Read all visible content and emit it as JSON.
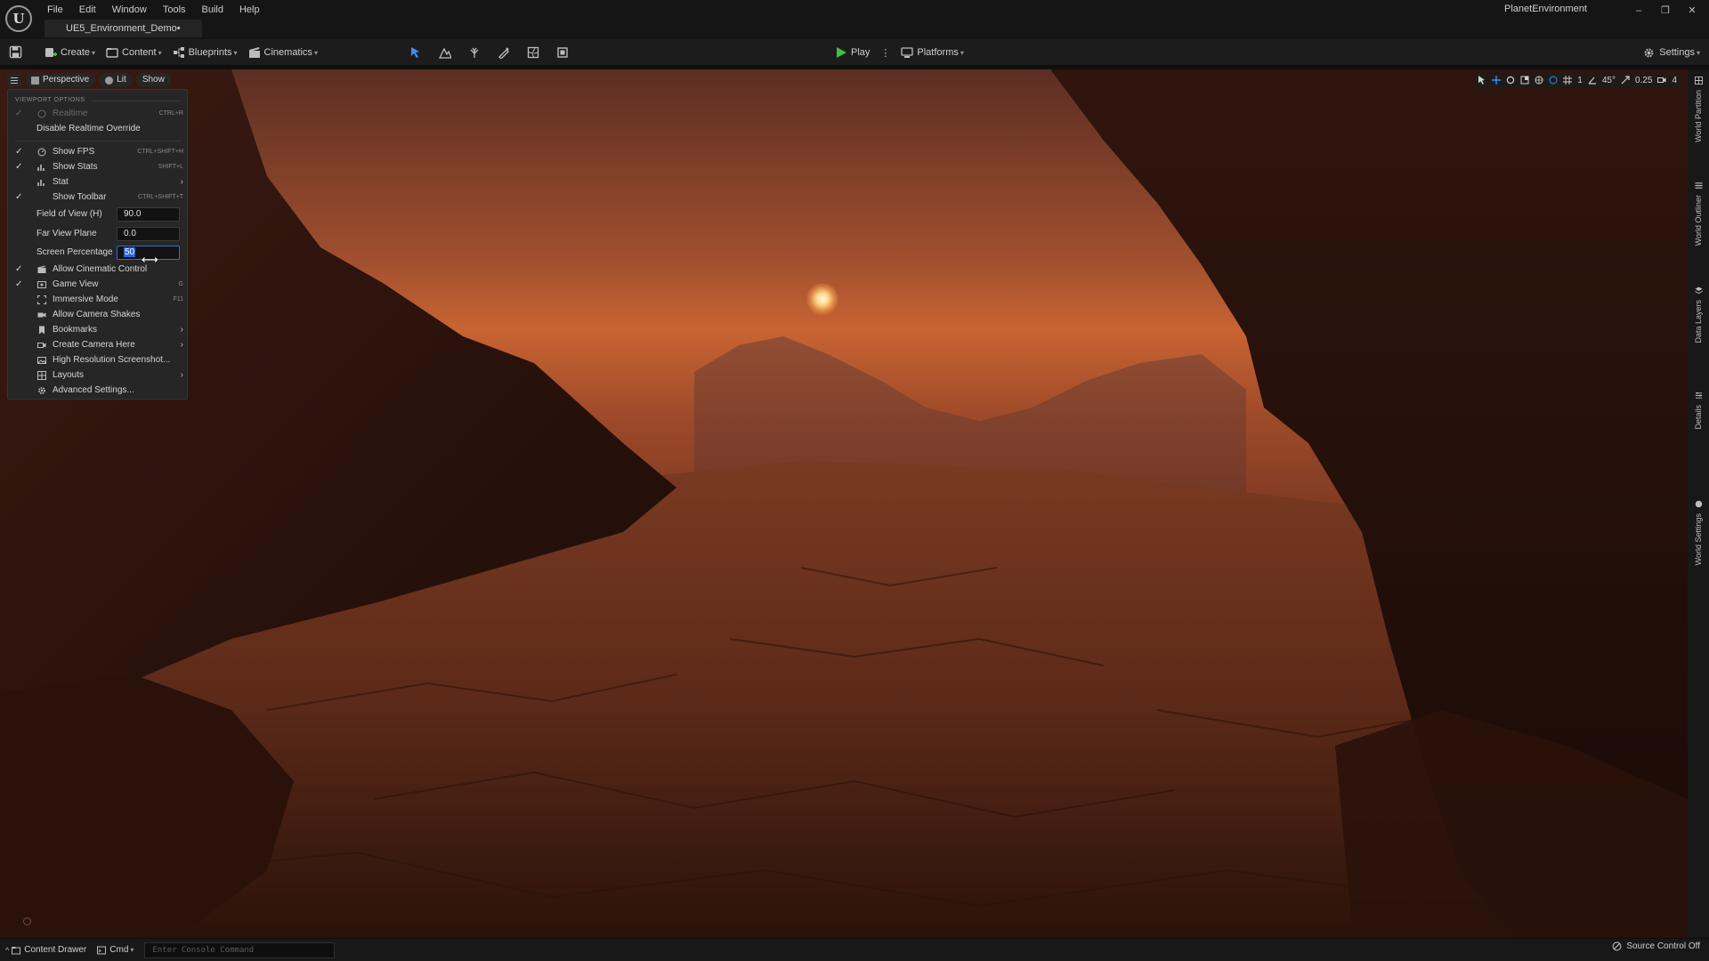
{
  "titlebar": {
    "logo": "U",
    "menus": [
      "File",
      "Edit",
      "Window",
      "Tools",
      "Build",
      "Help"
    ],
    "document_tab": "UE5_Environment_Demo•",
    "project_name": "PlanetEnvironment",
    "window_controls": [
      "–",
      "❐",
      "✕"
    ]
  },
  "toolbar": {
    "create": "Create",
    "content": "Content",
    "blueprints": "Blueprints",
    "cinematics": "Cinematics",
    "play": "Play",
    "play_more": "⋮",
    "platforms": "Platforms",
    "settings": "Settings",
    "mode_icons": [
      "select-mode-icon",
      "landscape-mode-icon",
      "foliage-mode-icon",
      "mesh-paint-mode-icon",
      "fracture-mode-icon",
      "modeling-mode-icon"
    ]
  },
  "viewport": {
    "perspective": "Perspective",
    "lit": "Lit",
    "show": "Show",
    "grid_snap": "1",
    "rotation_snap": "45°",
    "scale_snap": "0.25",
    "camera_speed": "4"
  },
  "viewport_options": {
    "header": "VIEWPORT OPTIONS",
    "realtime": "Realtime",
    "realtime_shortcut": "CTRL+R",
    "disable_realtime_override": "Disable Realtime Override",
    "show_fps": "Show FPS",
    "show_fps_shortcut": "CTRL+SHIFT+H",
    "show_stats": "Show Stats",
    "show_stats_shortcut": "SHIFT+L",
    "stat": "Stat",
    "show_toolbar": "Show Toolbar",
    "show_toolbar_shortcut": "CTRL+SHIFT+T",
    "fov_label": "Field of View (H)",
    "fov_value": "90.0",
    "far_view_label": "Far View Plane",
    "far_view_value": "0.0",
    "screen_pct_label": "Screen Percentage",
    "screen_pct_value": "50",
    "allow_cinematic": "Allow Cinematic Control",
    "game_view": "Game View",
    "game_view_shortcut": "G",
    "immersive_mode": "Immersive Mode",
    "immersive_shortcut": "F11",
    "camera_shakes": "Allow Camera Shakes",
    "bookmarks": "Bookmarks",
    "create_camera": "Create Camera Here",
    "high_res": "High Resolution Screenshot...",
    "layouts": "Layouts",
    "advanced": "Advanced Settings..."
  },
  "side_tabs": [
    "World Partition",
    "World Outliner",
    "Data Layers",
    "Details",
    "World Settings"
  ],
  "statusbar": {
    "content_drawer": "Content Drawer",
    "cmd": "Cmd",
    "console_placeholder": "Enter Console Command",
    "source_control": "Source Control Off"
  },
  "colors": {
    "accent_blue": "#2a66d9",
    "play_green": "#3fbf3f",
    "panel_bg": "#262626"
  }
}
